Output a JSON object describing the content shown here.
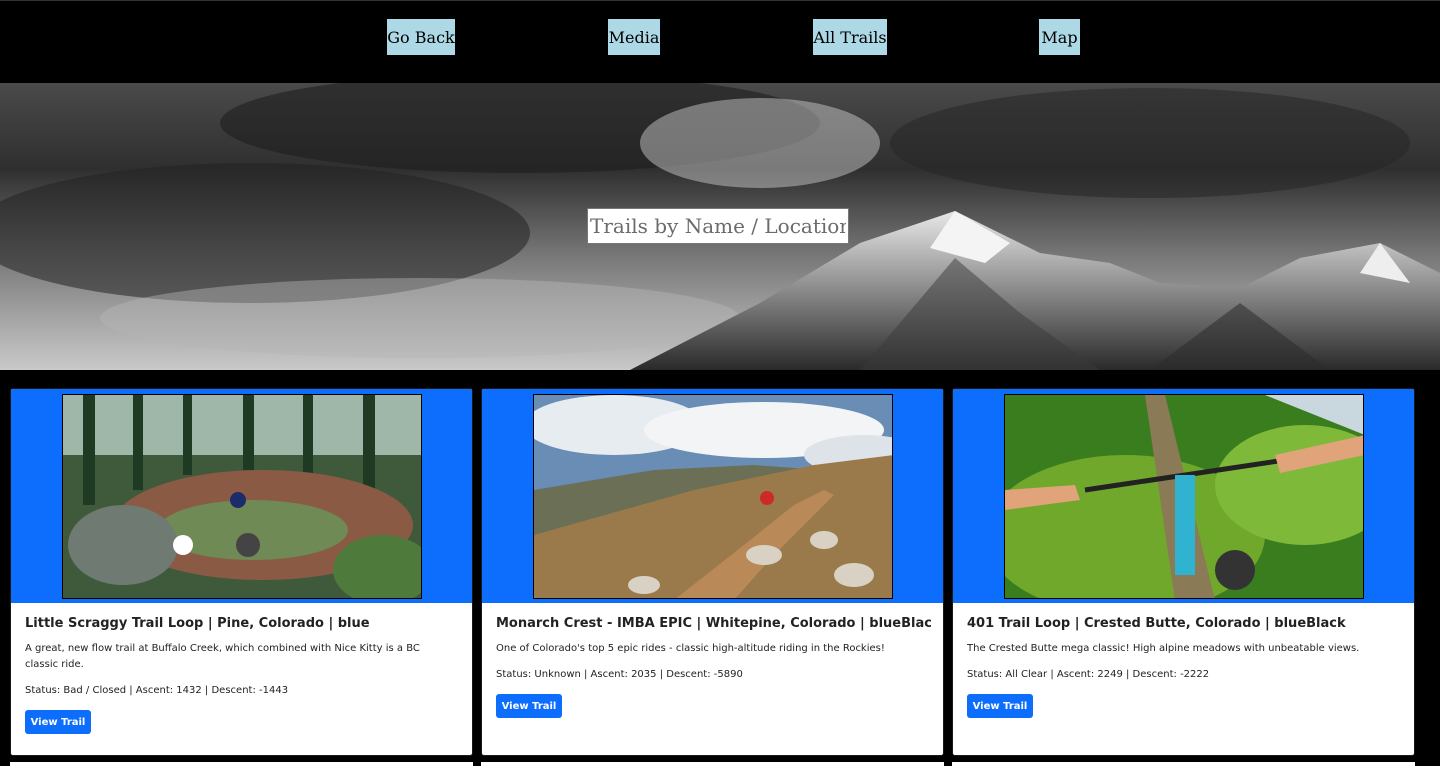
{
  "nav": {
    "items": [
      {
        "label": "Go Back"
      },
      {
        "label": "Media"
      },
      {
        "label": "All Trails"
      },
      {
        "label": "Map"
      }
    ]
  },
  "hero": {
    "search_placeholder": "Trails by Name / Location"
  },
  "trails": [
    {
      "title": "Little Scraggy Trail Loop | Pine, Colorado | blue",
      "description": "A great, new flow trail at Buffalo Creek, which combined with Nice Kitty is a BC classic ride.",
      "status": "Status: Bad / Closed | Ascent: 1432 | Descent: -1443",
      "button": "View Trail"
    },
    {
      "title": "Monarch Crest - IMBA EPIC | Whitepine, Colorado | blueBlack",
      "description": "One of Colorado's top 5 epic rides - classic high-altitude riding in the Rockies!",
      "status": "Status: Unknown | Ascent: 2035 | Descent: -5890",
      "button": "View Trail"
    },
    {
      "title": "401 Trail Loop | Crested Butte, Colorado | blueBlack",
      "description": "The Crested Butte mega classic! High alpine meadows with unbeatable views.",
      "status": "Status: All Clear | Ascent: 2249 | Descent: -2222",
      "button": "View Trail"
    }
  ],
  "colors": {
    "nav_button": "#add8e6",
    "card_band": "#0d6efd",
    "primary_button": "#0d6efd"
  }
}
